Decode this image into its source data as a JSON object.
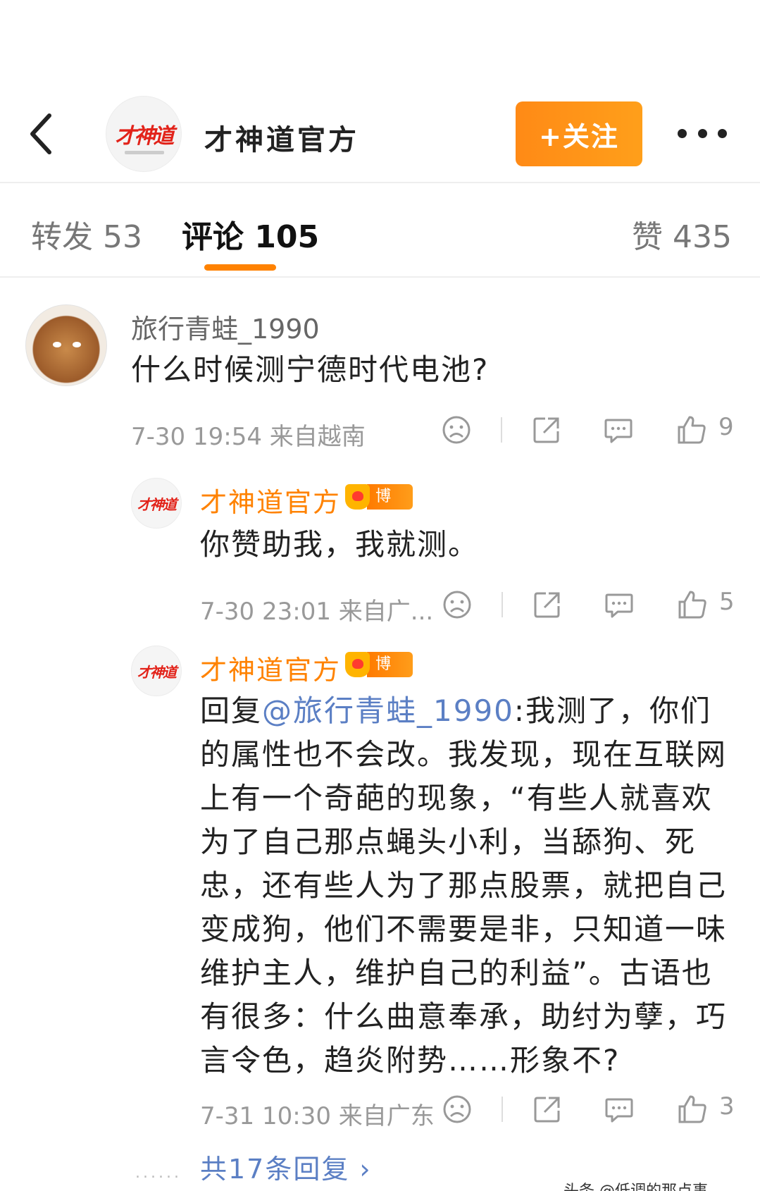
{
  "header": {
    "title": "才神道官方",
    "logo_text": "才神道",
    "follow_label": "+关注"
  },
  "tabs": {
    "repost": "转发 53",
    "comments": "评论 105",
    "likes": "赞 435"
  },
  "comments": [
    {
      "username": "旅行青蛙_1990",
      "text": "什么时候测宁德时代电池?",
      "meta": "7-30 19:54  来自越南",
      "likes": "9"
    }
  ],
  "replies": [
    {
      "username": "才神道官方",
      "badge": "博主",
      "text": "你赞助我，我就测。",
      "meta": "7-30 23:01  来自广...",
      "likes": "5"
    },
    {
      "username": "才神道官方",
      "badge": "博主",
      "reply_prefix": "回复",
      "mention": "@旅行青蛙_1990",
      "text": ":我测了，你们的属性也不会改。我发现，现在互联网上有一个奇葩的现象，“有些人就喜欢为了自己那点蝇头小利，当舔狗、死忠，还有些人为了那点股票，就把自己变成狗，他们不需要是非，只知道一味维护主人，维护自己的利益”。古语也有很多：什么曲意奉承，助纣为孽，巧言令色，趋炎附势……形象不?",
      "meta": "7-31 10:30  来自广东",
      "likes": "3"
    }
  ],
  "replies_link": "共17条回复 ›",
  "watermark": "头条 @低调的那点事"
}
